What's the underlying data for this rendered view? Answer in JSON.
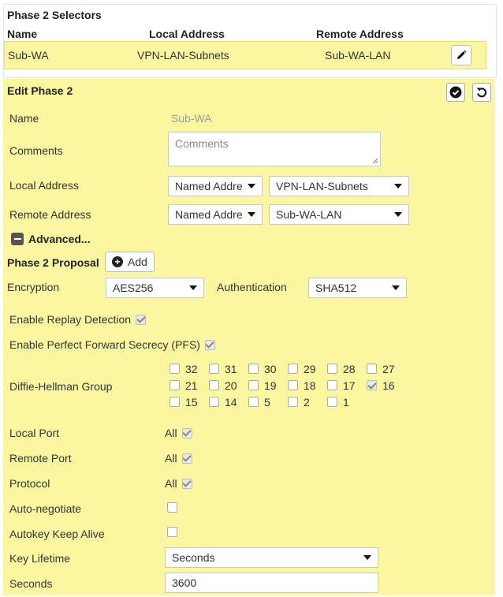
{
  "selectors": {
    "title": "Phase 2 Selectors",
    "columns": [
      "Name",
      "Local Address",
      "Remote Address"
    ],
    "row": {
      "name": "Sub-WA",
      "local": "VPN-LAN-Subnets",
      "remote": "Sub-WA-LAN"
    }
  },
  "edit": {
    "title": "Edit Phase 2",
    "name_label": "Name",
    "name_value": "Sub-WA",
    "comments_label": "Comments",
    "comments_placeholder": "Comments",
    "local_address_label": "Local Address",
    "local_type": "Named Address",
    "local_value": "VPN-LAN-Subnets",
    "remote_address_label": "Remote Address",
    "remote_type": "Named Address",
    "remote_value": "Sub-WA-LAN",
    "advanced_label": "Advanced...",
    "proposal_label": "Phase 2 Proposal",
    "add_label": "Add",
    "encryption_label": "Encryption",
    "encryption_value": "AES256",
    "authentication_label": "Authentication",
    "authentication_value": "SHA512",
    "replay_label": "Enable Replay Detection",
    "pfs_label": "Enable Perfect Forward Secrecy (PFS)",
    "dh_label": "Diffie-Hellman Group",
    "dh_groups": [
      [
        {
          "v": "32",
          "c": false
        },
        {
          "v": "31",
          "c": false
        },
        {
          "v": "30",
          "c": false
        },
        {
          "v": "29",
          "c": false
        },
        {
          "v": "28",
          "c": false
        },
        {
          "v": "27",
          "c": false
        }
      ],
      [
        {
          "v": "21",
          "c": false
        },
        {
          "v": "20",
          "c": false
        },
        {
          "v": "19",
          "c": false
        },
        {
          "v": "18",
          "c": false
        },
        {
          "v": "17",
          "c": false
        },
        {
          "v": "16",
          "c": true
        }
      ],
      [
        {
          "v": "15",
          "c": false
        },
        {
          "v": "14",
          "c": false
        },
        {
          "v": "5",
          "c": false
        },
        {
          "v": "2",
          "c": false
        },
        {
          "v": "1",
          "c": false
        }
      ]
    ],
    "local_port_label": "Local Port",
    "local_port_value": "All",
    "remote_port_label": "Remote Port",
    "remote_port_value": "All",
    "protocol_label": "Protocol",
    "protocol_value": "All",
    "auto_negotiate_label": "Auto-negotiate",
    "keep_alive_label": "Autokey Keep Alive",
    "key_lifetime_label": "Key Lifetime",
    "key_lifetime_value": "Seconds",
    "seconds_label": "Seconds",
    "seconds_value": "3600"
  },
  "icons": {
    "edit": "pencil-icon",
    "apply": "check-circle-icon",
    "revert": "undo-icon",
    "add": "plus-circle-icon",
    "collapse": "minus-square-icon"
  },
  "colors": {
    "panel_bg": "#fbf7a0",
    "row_border": "#e2dc79"
  }
}
